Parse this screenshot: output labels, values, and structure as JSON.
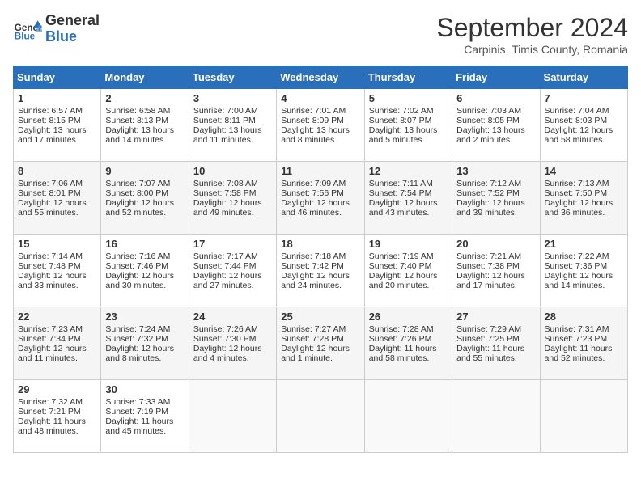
{
  "header": {
    "logo_general": "General",
    "logo_blue": "Blue",
    "title": "September 2024",
    "subtitle": "Carpinis, Timis County, Romania"
  },
  "calendar": {
    "days_of_week": [
      "Sunday",
      "Monday",
      "Tuesday",
      "Wednesday",
      "Thursday",
      "Friday",
      "Saturday"
    ],
    "weeks": [
      [
        {
          "day": "1",
          "lines": [
            "Sunrise: 6:57 AM",
            "Sunset: 8:15 PM",
            "Daylight: 13 hours",
            "and 17 minutes."
          ]
        },
        {
          "day": "2",
          "lines": [
            "Sunrise: 6:58 AM",
            "Sunset: 8:13 PM",
            "Daylight: 13 hours",
            "and 14 minutes."
          ]
        },
        {
          "day": "3",
          "lines": [
            "Sunrise: 7:00 AM",
            "Sunset: 8:11 PM",
            "Daylight: 13 hours",
            "and 11 minutes."
          ]
        },
        {
          "day": "4",
          "lines": [
            "Sunrise: 7:01 AM",
            "Sunset: 8:09 PM",
            "Daylight: 13 hours",
            "and 8 minutes."
          ]
        },
        {
          "day": "5",
          "lines": [
            "Sunrise: 7:02 AM",
            "Sunset: 8:07 PM",
            "Daylight: 13 hours",
            "and 5 minutes."
          ]
        },
        {
          "day": "6",
          "lines": [
            "Sunrise: 7:03 AM",
            "Sunset: 8:05 PM",
            "Daylight: 13 hours",
            "and 2 minutes."
          ]
        },
        {
          "day": "7",
          "lines": [
            "Sunrise: 7:04 AM",
            "Sunset: 8:03 PM",
            "Daylight: 12 hours",
            "and 58 minutes."
          ]
        }
      ],
      [
        {
          "day": "8",
          "lines": [
            "Sunrise: 7:06 AM",
            "Sunset: 8:01 PM",
            "Daylight: 12 hours",
            "and 55 minutes."
          ]
        },
        {
          "day": "9",
          "lines": [
            "Sunrise: 7:07 AM",
            "Sunset: 8:00 PM",
            "Daylight: 12 hours",
            "and 52 minutes."
          ]
        },
        {
          "day": "10",
          "lines": [
            "Sunrise: 7:08 AM",
            "Sunset: 7:58 PM",
            "Daylight: 12 hours",
            "and 49 minutes."
          ]
        },
        {
          "day": "11",
          "lines": [
            "Sunrise: 7:09 AM",
            "Sunset: 7:56 PM",
            "Daylight: 12 hours",
            "and 46 minutes."
          ]
        },
        {
          "day": "12",
          "lines": [
            "Sunrise: 7:11 AM",
            "Sunset: 7:54 PM",
            "Daylight: 12 hours",
            "and 43 minutes."
          ]
        },
        {
          "day": "13",
          "lines": [
            "Sunrise: 7:12 AM",
            "Sunset: 7:52 PM",
            "Daylight: 12 hours",
            "and 39 minutes."
          ]
        },
        {
          "day": "14",
          "lines": [
            "Sunrise: 7:13 AM",
            "Sunset: 7:50 PM",
            "Daylight: 12 hours",
            "and 36 minutes."
          ]
        }
      ],
      [
        {
          "day": "15",
          "lines": [
            "Sunrise: 7:14 AM",
            "Sunset: 7:48 PM",
            "Daylight: 12 hours",
            "and 33 minutes."
          ]
        },
        {
          "day": "16",
          "lines": [
            "Sunrise: 7:16 AM",
            "Sunset: 7:46 PM",
            "Daylight: 12 hours",
            "and 30 minutes."
          ]
        },
        {
          "day": "17",
          "lines": [
            "Sunrise: 7:17 AM",
            "Sunset: 7:44 PM",
            "Daylight: 12 hours",
            "and 27 minutes."
          ]
        },
        {
          "day": "18",
          "lines": [
            "Sunrise: 7:18 AM",
            "Sunset: 7:42 PM",
            "Daylight: 12 hours",
            "and 24 minutes."
          ]
        },
        {
          "day": "19",
          "lines": [
            "Sunrise: 7:19 AM",
            "Sunset: 7:40 PM",
            "Daylight: 12 hours",
            "and 20 minutes."
          ]
        },
        {
          "day": "20",
          "lines": [
            "Sunrise: 7:21 AM",
            "Sunset: 7:38 PM",
            "Daylight: 12 hours",
            "and 17 minutes."
          ]
        },
        {
          "day": "21",
          "lines": [
            "Sunrise: 7:22 AM",
            "Sunset: 7:36 PM",
            "Daylight: 12 hours",
            "and 14 minutes."
          ]
        }
      ],
      [
        {
          "day": "22",
          "lines": [
            "Sunrise: 7:23 AM",
            "Sunset: 7:34 PM",
            "Daylight: 12 hours",
            "and 11 minutes."
          ]
        },
        {
          "day": "23",
          "lines": [
            "Sunrise: 7:24 AM",
            "Sunset: 7:32 PM",
            "Daylight: 12 hours",
            "and 8 minutes."
          ]
        },
        {
          "day": "24",
          "lines": [
            "Sunrise: 7:26 AM",
            "Sunset: 7:30 PM",
            "Daylight: 12 hours",
            "and 4 minutes."
          ]
        },
        {
          "day": "25",
          "lines": [
            "Sunrise: 7:27 AM",
            "Sunset: 7:28 PM",
            "Daylight: 12 hours",
            "and 1 minute."
          ]
        },
        {
          "day": "26",
          "lines": [
            "Sunrise: 7:28 AM",
            "Sunset: 7:26 PM",
            "Daylight: 11 hours",
            "and 58 minutes."
          ]
        },
        {
          "day": "27",
          "lines": [
            "Sunrise: 7:29 AM",
            "Sunset: 7:25 PM",
            "Daylight: 11 hours",
            "and 55 minutes."
          ]
        },
        {
          "day": "28",
          "lines": [
            "Sunrise: 7:31 AM",
            "Sunset: 7:23 PM",
            "Daylight: 11 hours",
            "and 52 minutes."
          ]
        }
      ],
      [
        {
          "day": "29",
          "lines": [
            "Sunrise: 7:32 AM",
            "Sunset: 7:21 PM",
            "Daylight: 11 hours",
            "and 48 minutes."
          ]
        },
        {
          "day": "30",
          "lines": [
            "Sunrise: 7:33 AM",
            "Sunset: 7:19 PM",
            "Daylight: 11 hours",
            "and 45 minutes."
          ]
        },
        {
          "day": "",
          "lines": []
        },
        {
          "day": "",
          "lines": []
        },
        {
          "day": "",
          "lines": []
        },
        {
          "day": "",
          "lines": []
        },
        {
          "day": "",
          "lines": []
        }
      ]
    ]
  }
}
